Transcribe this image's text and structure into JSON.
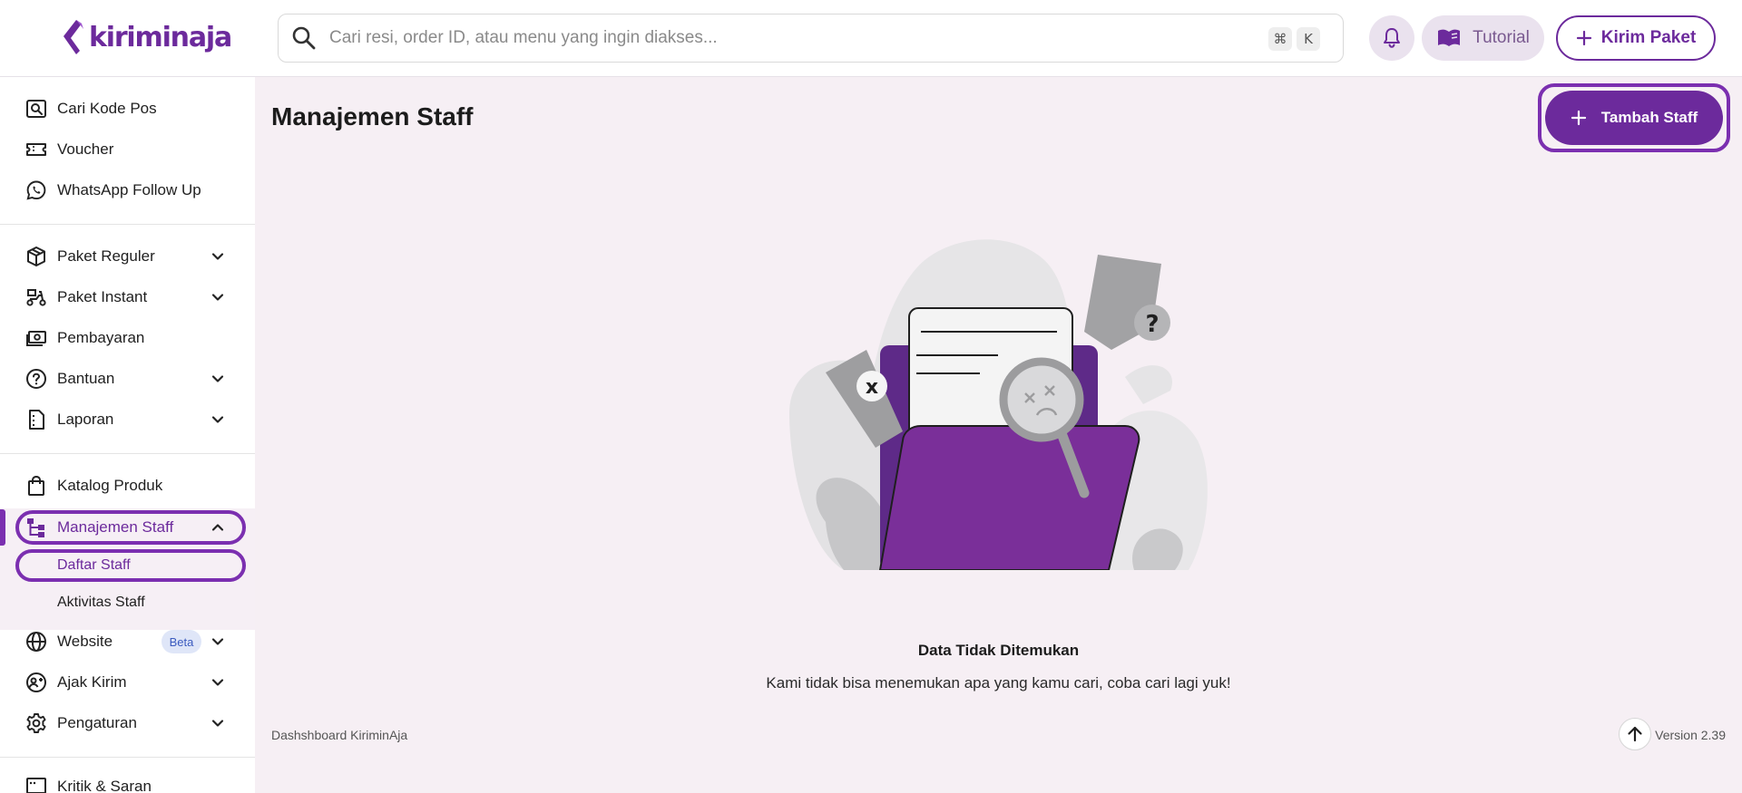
{
  "header": {
    "logo_text": "kiriminaja",
    "search_placeholder": "Cari resi, order ID, atau menu yang ingin diakses...",
    "shortcut_keys": [
      "⌘",
      "K"
    ],
    "tutorial_label": "Tutorial",
    "kirim_label": "Kirim Paket"
  },
  "sidebar": {
    "top_items": [
      {
        "label": "Cari Kode Pos",
        "icon": "postcode-search-icon"
      },
      {
        "label": "Voucher",
        "icon": "ticket-icon"
      },
      {
        "label": "WhatsApp Follow Up",
        "icon": "whatsapp-icon"
      }
    ],
    "main_items": [
      {
        "label": "Paket Reguler",
        "icon": "box-icon"
      },
      {
        "label": "Paket Instant",
        "icon": "scooter-icon"
      },
      {
        "label": "Pembayaran",
        "icon": "money-icon"
      },
      {
        "label": "Bantuan",
        "icon": "help-icon"
      },
      {
        "label": "Laporan",
        "icon": "report-icon"
      }
    ],
    "catalog_label": "Katalog Produk",
    "staff": {
      "label": "Manajemen Staff",
      "sub": [
        "Daftar Staff",
        "Aktivitas Staff"
      ]
    },
    "website_label": "Website",
    "beta_label": "Beta",
    "ajak_label": "Ajak Kirim",
    "pengaturan_label": "Pengaturan",
    "kritik_label": "Kritik & Saran"
  },
  "main": {
    "title": "Manajemen Staff",
    "add_button": "Tambah Staff",
    "empty_title": "Data Tidak Ditemukan",
    "empty_desc": "Kami tidak bisa menemukan apa yang kamu cari, coba cari lagi yuk!",
    "footer_left": "Dashshboard KiriminAja",
    "footer_right": "Version 2.39"
  },
  "colors": {
    "brand": "#6c2a9c",
    "highlight": "#7b2fb0",
    "main_bg": "#f6eff4"
  }
}
